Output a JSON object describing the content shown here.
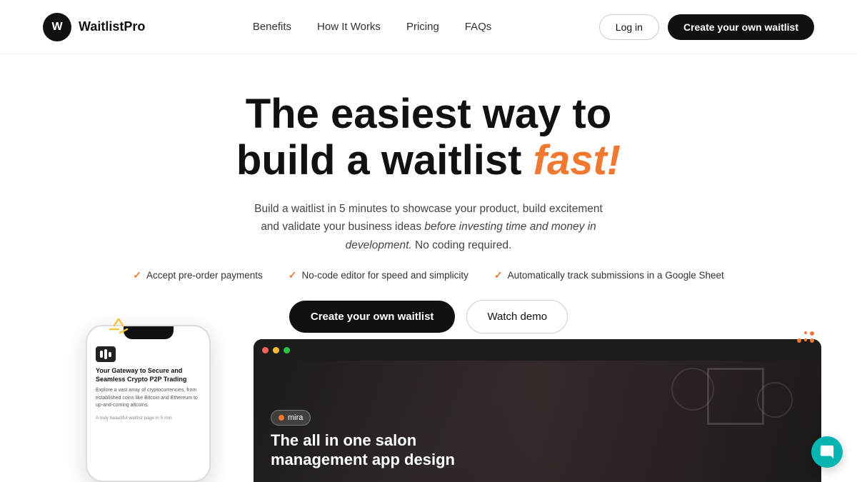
{
  "brand": {
    "logo_letter": "W",
    "name": "WaitlistPro"
  },
  "navbar": {
    "links": [
      {
        "label": "Benefits",
        "id": "benefits"
      },
      {
        "label": "How It Works",
        "id": "how-it-works"
      },
      {
        "label": "Pricing",
        "id": "pricing"
      },
      {
        "label": "FAQs",
        "id": "faqs"
      }
    ],
    "login_label": "Log in",
    "cta_label": "Create your own waitlist"
  },
  "hero": {
    "title_line1": "The easiest way to",
    "title_line2": "build a waitlist",
    "title_accent": "fast!",
    "subtitle_before": "Build a waitlist in 5 minutes to showcase your product, build excitement and validate your business ideas",
    "subtitle_italic": " before investing time and money in development.",
    "subtitle_after": " No coding required.",
    "features": [
      {
        "text": "Accept pre-order payments"
      },
      {
        "text": "No-code editor for speed and simplicity"
      },
      {
        "text": "Automatically track submissions in a Google Sheet"
      }
    ],
    "cta_label": "Create your own waitlist",
    "demo_label": "Watch demo"
  },
  "browser_preview": {
    "brand_badge": "mira",
    "big_text_line1": "The all in one salon",
    "big_text_line2": "management app design"
  },
  "phone_preview": {
    "app_title": "Your Gateway to Secure and Seamless Crypto P2P Trading",
    "app_body": "Explore a vast array of cryptocurrencies, from established coins like Bitcoin and Ethereum to up-and-coming altcoins.",
    "app_footer": "A truly beautiful waitlist page in 5 min"
  },
  "chat": {
    "icon": "💬"
  },
  "colors": {
    "accent": "#f07830",
    "cta_bg": "#111111",
    "teal": "#0ab4b0"
  }
}
